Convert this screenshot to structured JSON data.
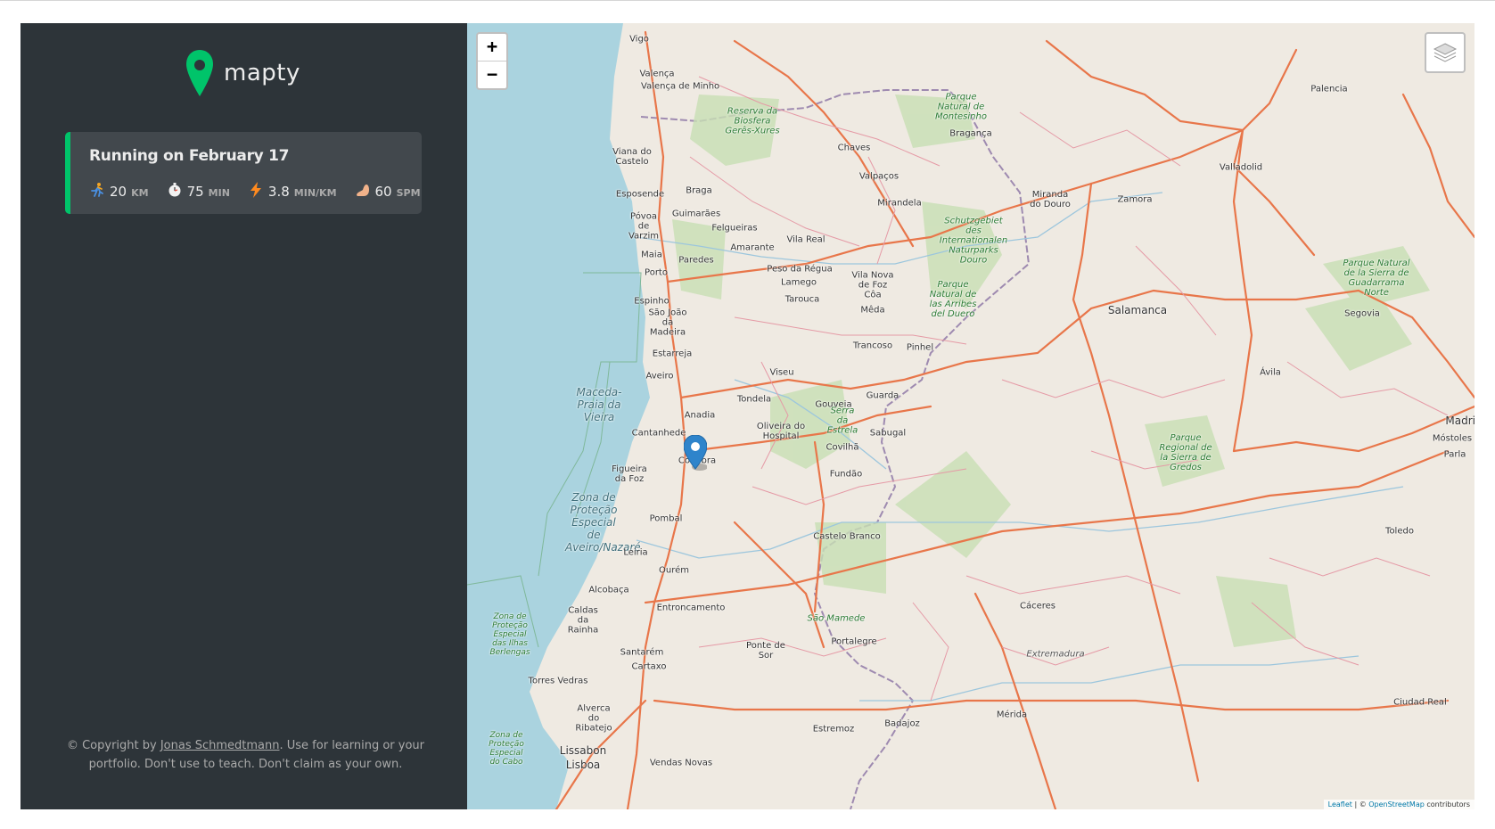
{
  "app": {
    "name": "mapty",
    "brand_color": "#00c46a"
  },
  "workouts": [
    {
      "title": "Running on February 17",
      "type": "running",
      "accent_color": "#00c46a",
      "details": [
        {
          "icon": "runner-icon",
          "value": "20",
          "unit": "km"
        },
        {
          "icon": "stopwatch-icon",
          "value": "75",
          "unit": "min"
        },
        {
          "icon": "lightning-icon",
          "value": "3.8",
          "unit": "min/km"
        },
        {
          "icon": "footprint-icon",
          "value": "60",
          "unit": "spm"
        }
      ]
    }
  ],
  "footer": {
    "prefix": "© Copyright by ",
    "author": "Jonas Schmedtmann",
    "suffix": ". Use for learning or your portfolio. Don't use to teach. Don't claim as your own."
  },
  "map": {
    "zoom_in": "+",
    "zoom_out": "−",
    "attribution_leaflet": "Leaflet",
    "attribution_sep": " | © ",
    "attribution_osm": "OpenStreetMap",
    "attribution_suffix": " contributors",
    "places": [
      "Vigo",
      "Valença",
      "Valença de Minho",
      "Reserva da Biosfera Gerês-Xures",
      "Parque Natural de Montesinho",
      "Bragança",
      "Palencia",
      "Viana do Castelo",
      "Chaves",
      "Valpaços",
      "Valladolid",
      "Esposende",
      "Braga",
      "Mirandela",
      "Miranda do Douro",
      "Zamora",
      "Guimarães",
      "Póvoa de Varzim",
      "Felgueiras",
      "Schutzgebiet des Internationalen Naturparks Douro",
      "Maia",
      "Amarante",
      "Vila Real",
      "Paredes",
      "Porto",
      "Peso da Régua",
      "Lamego",
      "Vila Nova de Foz Côa",
      "Parque Natural de las Arribes del Duero",
      "Parque Natural de la Sierra de Guadarrama Norte",
      "Espinho",
      "Tarouca",
      "Mêda",
      "Salamanca",
      "Segovia",
      "São João da Madeira",
      "Estarreja",
      "Trancoso",
      "Pinhel",
      "Aveiro",
      "Viseu",
      "Ávila",
      "Maceda-Praia da Vieira",
      "Tondela",
      "Gouveia",
      "Guarda",
      "Serra da Estrela",
      "Anadia",
      "Oliveira do Hospital",
      "Sabugal",
      "Cantanhede",
      "Covilhã",
      "Coimbra",
      "Figueira da Foz",
      "Fundão",
      "Parque Regional de la Sierra de Gredos",
      "Móstoles",
      "Parla",
      "Madrid",
      "Zona de Proteção Especial de Aveiro/Nazaré",
      "Pombal",
      "Castelo Branco",
      "Toledo",
      "Leiria",
      "Ourém",
      "Alcobaça",
      "Entroncamento",
      "Cáceres",
      "São Mamede",
      "Caldas da Rainha",
      "Zona de Proteção Especial das Ilhas Berlengas",
      "Ponte de Sor",
      "Portalegre",
      "Santarém",
      "Extremadura",
      "Cartaxo",
      "Torres Vedras",
      "Ciudad Real",
      "Alverca do Ribatejo",
      "Mérida",
      "Badajoz",
      "Estremoz",
      "Lissabon",
      "Lisboa",
      "Zona de Proteção Especial do Cabo",
      "Vendas Novas"
    ]
  }
}
